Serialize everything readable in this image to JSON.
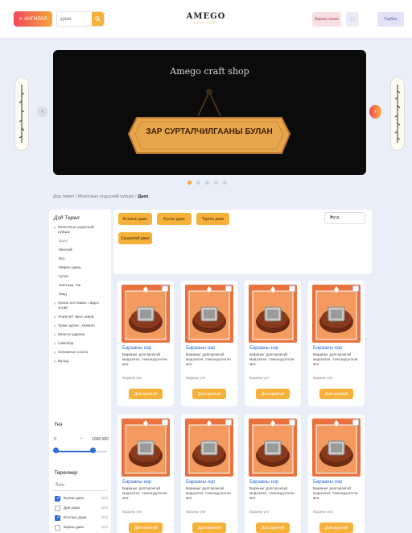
{
  "header": {
    "category_label": "АНГИЛАЛ",
    "search_placeholder": "Даах",
    "logo_text": "AMEGO",
    "logo_subtitle": "CRAFT SHOP",
    "login_label": "Бараа нэмэх",
    "cart_label": "Торбоо"
  },
  "banner": {
    "title": "Amego craft shop",
    "sign_text": "ЗАР СУРТАЛЧИЛГААНЫ БУЛАН",
    "slides": 5,
    "active_slide": 0
  },
  "breadcrumb": {
    "items": [
      "Дэд төрөл",
      "Монголын үндэсний хувцас"
    ],
    "current": "Даах"
  },
  "sidebar": {
    "title": "Дэд Төрөл",
    "items": [
      {
        "label": "Монголын үндэсний хувцас",
        "chevron": true,
        "sub": false,
        "active": false
      },
      {
        "label": "Даах",
        "chevron": false,
        "sub": true,
        "active": true
      },
      {
        "label": "Малгай",
        "chevron": false,
        "sub": true,
        "active": false
      },
      {
        "label": "Бүс",
        "chevron": false,
        "sub": true,
        "active": false
      },
      {
        "label": "Мөрөн цамц",
        "chevron": false,
        "sub": true,
        "active": false
      },
      {
        "label": "Гутал",
        "chevron": false,
        "sub": true,
        "active": false
      },
      {
        "label": "Хантааз, Уж",
        "chevron": false,
        "sub": true,
        "active": false
      },
      {
        "label": "Өмд",
        "chevron": false,
        "sub": true,
        "active": false
      },
      {
        "label": "Урлан хоттамал, ойдот, эсгий",
        "chevron": true,
        "sub": false,
        "active": false
      },
      {
        "label": "Угаасонт арьс шира",
        "chevron": true,
        "sub": false,
        "active": false
      },
      {
        "label": "Урам зургас, хааман",
        "chevron": true,
        "sub": false,
        "active": false
      },
      {
        "label": "Монгол дархан",
        "chevron": true,
        "sub": false,
        "active": false
      },
      {
        "label": "Сийлбэр",
        "chevron": true,
        "sub": false,
        "active": false
      },
      {
        "label": "Хатамлын хээсэг",
        "chevron": true,
        "sub": false,
        "active": false
      },
      {
        "label": "Бусад",
        "chevron": true,
        "sub": false,
        "active": false
      }
    ]
  },
  "price_filter": {
    "title": "Үнэ",
    "min": "0",
    "max": "1000 000",
    "range_low": 0,
    "range_high": 0.72
  },
  "type_filter": {
    "title": "Төрөлөөр",
    "search_placeholder": "Хайх",
    "items": [
      {
        "label": "Бүлан даах",
        "count": "(10)",
        "checked": true
      },
      {
        "label": "Дан даах",
        "count": "(10)",
        "checked": false
      },
      {
        "label": "Есхлын даах",
        "count": "(10)",
        "checked": true
      },
      {
        "label": "Бархи даах",
        "count": "(10)",
        "checked": false
      }
    ]
  },
  "tags": [
    "Есхлын даах",
    "Бүлан даах",
    "Торгон даах",
    "Хашаатай даах"
  ],
  "sort": {
    "selected": "Бүгд"
  },
  "products": {
    "name": "Барааны нэр",
    "description": "Бараныг дэлгэрэнгүй мэдээлэл, тэнхэцүүлэгэн мэт.",
    "price_label": "Бараны үнэ",
    "buy_label": "Дэлгэрэнгүй",
    "count": 8
  },
  "colors": {
    "accent": "#f6b13a",
    "brand_gradient_start": "#f04a5e",
    "link": "#2d6bd6",
    "page_bg": "#e9eef8"
  }
}
